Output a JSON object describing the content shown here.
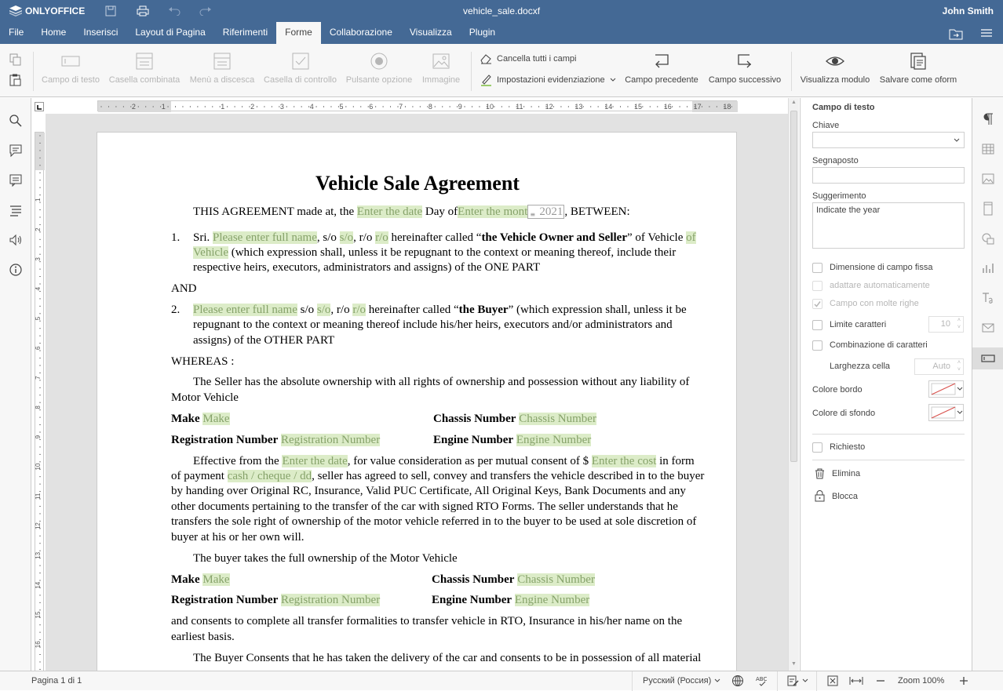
{
  "app": {
    "name": "ONLYOFFICE",
    "doc_title": "vehicle_sale.docxf",
    "user": "John Smith"
  },
  "menu_tabs": [
    "File",
    "Home",
    "Inserisci",
    "Layout di Pagina",
    "Riferimenti",
    "Forme",
    "Collaborazione",
    "Visualizza",
    "Plugin"
  ],
  "active_tab": "Forme",
  "toolbar": {
    "text_field": "Campo di testo",
    "combo_box": "Casella combinata",
    "dropdown": "Menù a discesca",
    "checkbox": "Casella di controllo",
    "radio": "Pulsante opzione",
    "image": "Immagine",
    "clear_fields": "Cancella tutti i campi",
    "highlight_settings": "Impostazioni evidenziazione",
    "prev_field": "Campo precedente",
    "next_field": "Campo successivo",
    "view_form": "Visualizza modulo",
    "save_oform": "Salvare come oform"
  },
  "ruler": {
    "h_labels": [
      "2",
      "1",
      "1",
      "2",
      "3",
      "4",
      "5",
      "6",
      "7",
      "8",
      "9",
      "10",
      "11",
      "12",
      "13",
      "14",
      "15",
      "16",
      "17",
      "18"
    ],
    "v_labels": [
      "1",
      "2",
      "3",
      "4",
      "5",
      "6",
      "7",
      "8",
      "9",
      "10",
      "11",
      "12",
      "13",
      "14",
      "15",
      "16"
    ]
  },
  "document": {
    "title": "Vehicle Sale Agreement",
    "intro": {
      "t1": "THIS AGREEMENT made at, the",
      "f1": "Enter the date",
      "t2": "Day of",
      "f2": "Enter the mont",
      "f3": "2021",
      "t3": ", BETWEEN:"
    },
    "p1": {
      "num": "1.",
      "l1": {
        "t1": "Sri.",
        "f1": "Please enter full name",
        "t2": ", s/o",
        "f2": "s/o",
        "t3": ", r/o",
        "f3": "r/o",
        "t4": "hereinafter called “",
        "b1": "the Vehicle Owner and Seller",
        "t5": "” of Vehicle",
        "f4": "of"
      },
      "l2": {
        "f1": "Vehicle",
        "t1": "(which expression shall, unless it be repugnant to the context or meaning thereof, include their"
      },
      "l3": "respective heirs, executors, administrators and assigns) of the ONE PART"
    },
    "and": "AND",
    "p2": {
      "num": "2.",
      "l1": {
        "f1": "Please enter full name",
        "t1": "s/o",
        "f2": "s/o",
        "t2": ", r/o",
        "f3": "r/o",
        "t3": "hereinafter called “",
        "b1": "the Buyer",
        "t4": "” (which expression shall, unless it be"
      },
      "l2": "repugnant to the context or meaning thereof include his/her heirs, executors and/or administrators and",
      "l3": "assigns) of the OTHER PART"
    },
    "whereas": "WHEREAS :",
    "seller_line1": "The Seller has the absolute ownership with all rights of ownership and possession without any liability of",
    "seller_line2": "Motor Vehicle",
    "fields1": {
      "make_l": "Make",
      "make_f": "Make",
      "chassis_l": "Chassis Number",
      "chassis_f": "Chassis Number",
      "reg_l": "Registration Number",
      "reg_f": "Registration Number",
      "engine_l": "Engine Number",
      "engine_f": "Engine Number"
    },
    "effective": {
      "l1": {
        "t1": "Effective from the",
        "f1": "Enter the date",
        "t2": ", for value consideration as per mutual consent of $",
        "f2": "Enter the cost",
        "t3": "in form"
      },
      "l2": {
        "t1": "of payment",
        "f1": "cash / cheque / dd",
        "t2": ", seller has agreed to sell, convey and transfers the vehicle described in to the buyer"
      },
      "l3": "by handing over Original RC, Insurance, Valid PUC Certificate, All Original Keys, Bank Documents and any",
      "l4": "other documents pertaining to the transfer of the car with signed RTO Forms. The seller understands that he",
      "l5": "transfers the sole right of ownership of the motor vehicle referred in to the buyer to be used at sole discretion of",
      "l6": "buyer at his or her own will."
    },
    "buyer_takes": "The buyer takes the full ownership of the Motor Vehicle",
    "fields2": {
      "make_l": "Make",
      "make_f": "Make",
      "chassis_l": "Chassis Number",
      "chassis_f": "Chassis Number",
      "reg_l": "Registration Number",
      "reg_f": "Registration Number",
      "engine_l": "Engine Number",
      "engine_f": "Engine Number"
    },
    "consents1": "and consents to complete all transfer formalities to transfer vehicle in RTO, Insurance in his/her name on the",
    "consents2": "earliest basis.",
    "buyer_consents": "The Buyer Consents that he has taken the delivery of the car and consents to be in possession of all material"
  },
  "right_panel": {
    "title": "Campo di testo",
    "key_label": "Chiave",
    "key_value": "",
    "placeholder_label": "Segnaposto",
    "placeholder_value": "",
    "tip_label": "Suggerimento",
    "tip_value": "Indicate the year",
    "fixed_size": "Dimensione di campo fissa",
    "autofit": "adattare automaticamente",
    "multiline": "Campo con molte righe",
    "char_limit": "Limite caratteri",
    "char_limit_value": "10",
    "comb": "Combinazione di caratteri",
    "cell_width": "Larghezza cella",
    "cell_width_value": "Auto",
    "border_color": "Colore bordo",
    "bg_color": "Colore di sfondo",
    "required": "Richiesto",
    "delete": "Elimina",
    "lock": "Blocca"
  },
  "status": {
    "page": "Pagina 1 di 1",
    "language": "Русский (Россия)",
    "zoom": "Zoom 100%"
  },
  "colors": {
    "header": "#446995",
    "field_bg": "#dcecc8",
    "field_text": "#86a26a",
    "accent_red": "#d9534f"
  }
}
